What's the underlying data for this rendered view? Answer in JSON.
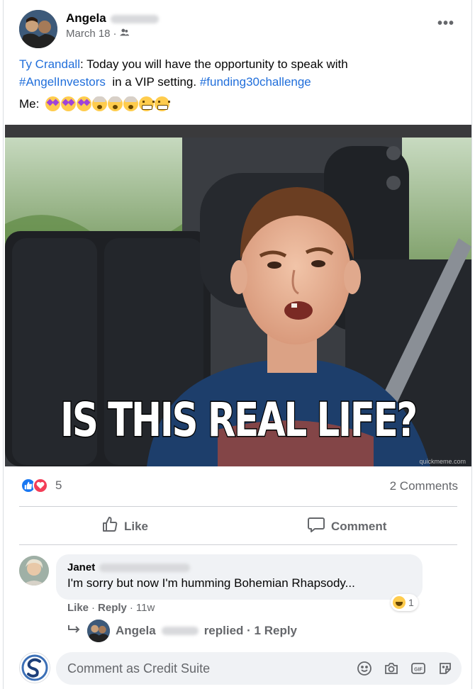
{
  "post": {
    "author_first": "Angela",
    "date": "March 18",
    "dot": "·",
    "more": "•••",
    "mention": "Ty Crandall",
    "text_a": ": Today you will have the opportunity to speak with",
    "hashtag1": "#AngelInvestors",
    "text_b": "  in a VIP setting. ",
    "hashtag2": "#funding30challenge",
    "me_label": "Me:",
    "image_caption": "IS THIS REAL LIFE?",
    "image_watermark": "quickmeme.com"
  },
  "stats": {
    "reaction_count": "5",
    "comments": "2 Comments"
  },
  "actions": {
    "like": "Like",
    "comment": "Comment"
  },
  "comment": {
    "author_first": "Janet",
    "text": "I'm sorry but now I'm humming Bohemian Rhapsody...",
    "reaction_count": "1",
    "like": "Like",
    "reply": "Reply",
    "time": "11w",
    "sep": "·"
  },
  "replies": {
    "author_first": "Angela",
    "text": "replied · 1 Reply"
  },
  "composer": {
    "placeholder": "Comment as Credit Suite"
  },
  "colors": {
    "link": "#216fdb",
    "like_blue": "#1877f2",
    "love_red": "#f33e58",
    "muted": "#65676b"
  }
}
